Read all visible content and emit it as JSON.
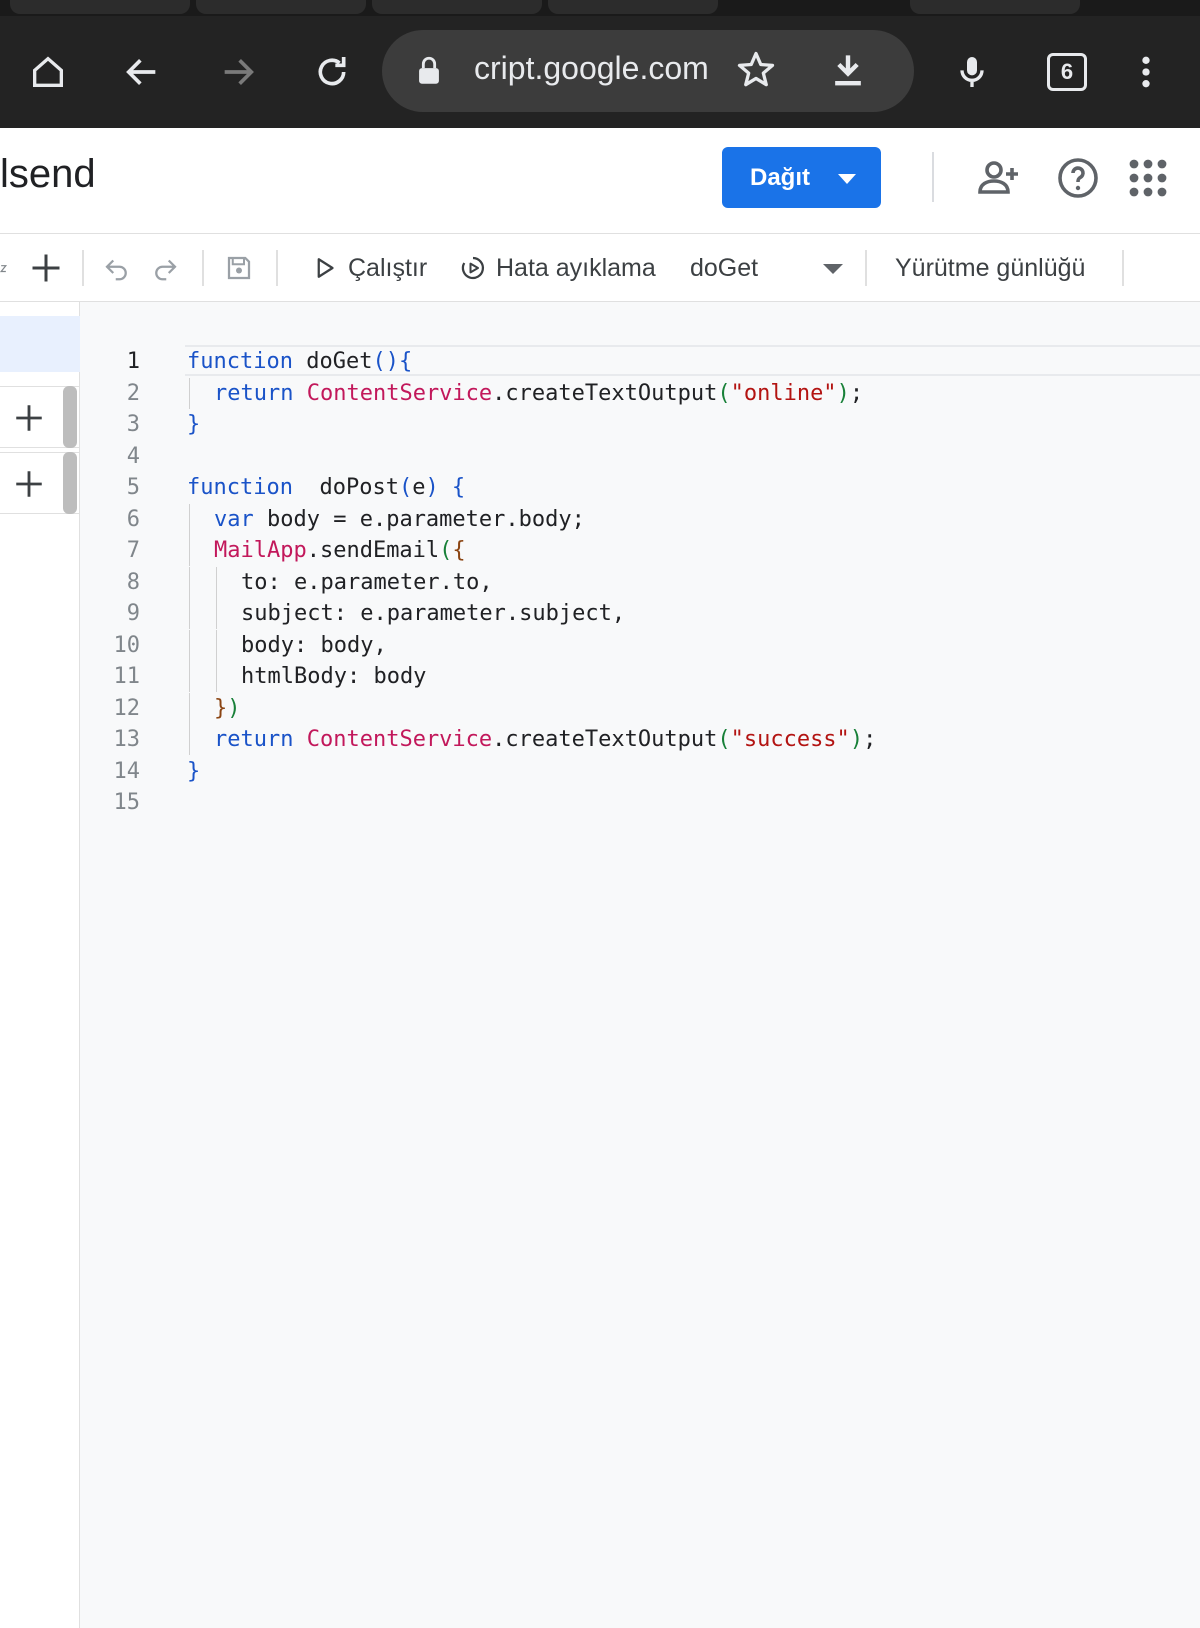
{
  "browser": {
    "url": "cript.google.com",
    "tab_count": "6"
  },
  "header": {
    "project_title": "lsend",
    "deploy_label": "Dağıt"
  },
  "toolbar": {
    "run_label": "Çalıştır",
    "debug_label": "Hata ayıklama",
    "function_select": "doGet",
    "execution_log_label": "Yürütme günlüğü"
  },
  "editor": {
    "active_line": 1,
    "lines": [
      {
        "n": "1",
        "indent": 0,
        "tokens": [
          [
            "kw",
            "function"
          ],
          [
            "",
            "doGet"
          ],
          [
            "pb",
            "(){"
          ]
        ]
      },
      {
        "n": "2",
        "indent": 1,
        "tokens": [
          [
            "kw",
            "return"
          ],
          [
            "",
            " "
          ],
          [
            "ty",
            "ContentService"
          ],
          [
            "",
            ".createTextOutput"
          ],
          [
            "pg",
            "("
          ],
          [
            "str",
            "\"online\""
          ],
          [
            "pg",
            ")"
          ],
          [
            "",
            ";"
          ]
        ]
      },
      {
        "n": "3",
        "indent": 0,
        "tokens": [
          [
            "pb",
            "}"
          ]
        ]
      },
      {
        "n": "4",
        "indent": 0,
        "tokens": []
      },
      {
        "n": "5",
        "indent": 0,
        "tokens": [
          [
            "kw",
            "function"
          ],
          [
            "",
            " doPost"
          ],
          [
            "pb",
            "("
          ],
          [
            "",
            "e"
          ],
          [
            "pb",
            ") {"
          ]
        ]
      },
      {
        "n": "6",
        "indent": 1,
        "tokens": [
          [
            "kw",
            "var"
          ],
          [
            "",
            " body = e.parameter.body;"
          ]
        ]
      },
      {
        "n": "7",
        "indent": 1,
        "tokens": [
          [
            "ty",
            "MailApp"
          ],
          [
            "",
            ".sendEmail"
          ],
          [
            "pg",
            "("
          ],
          [
            "pr",
            "{"
          ]
        ]
      },
      {
        "n": "8",
        "indent": 2,
        "tokens": [
          [
            "",
            "to: e.parameter.to,"
          ]
        ]
      },
      {
        "n": "9",
        "indent": 2,
        "tokens": [
          [
            "",
            "subject: e.parameter.subject,"
          ]
        ]
      },
      {
        "n": "10",
        "indent": 2,
        "tokens": [
          [
            "",
            "body: body,"
          ]
        ]
      },
      {
        "n": "11",
        "indent": 2,
        "tokens": [
          [
            "",
            "htmlBody: body"
          ]
        ]
      },
      {
        "n": "12",
        "indent": 1,
        "tokens": [
          [
            "pr",
            "}"
          ],
          [
            "pg",
            ")"
          ]
        ]
      },
      {
        "n": "13",
        "indent": 1,
        "tokens": [
          [
            "kw",
            "return"
          ],
          [
            "",
            " "
          ],
          [
            "ty",
            "ContentService"
          ],
          [
            "",
            ".createTextOutput"
          ],
          [
            "pg",
            "("
          ],
          [
            "str",
            "\"success\""
          ],
          [
            "pg",
            ")"
          ],
          [
            "",
            ";"
          ]
        ]
      },
      {
        "n": "14",
        "indent": 0,
        "tokens": [
          [
            "pb",
            "}"
          ]
        ]
      },
      {
        "n": "15",
        "indent": 0,
        "tokens": []
      }
    ]
  }
}
